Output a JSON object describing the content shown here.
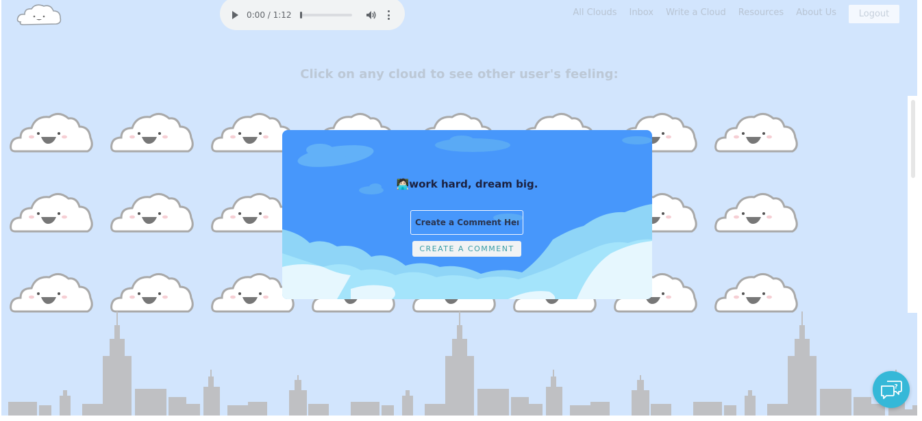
{
  "header": {
    "logo_icon": "cloud-logo-icon",
    "audio": {
      "time": "0:00 / 1:12"
    },
    "nav": [
      "All Clouds",
      "Inbox",
      "Write a Cloud",
      "Resources",
      "About Us"
    ],
    "logout_label": "Logout"
  },
  "main": {
    "headline": "Click on any cloud to see other user's feeling:",
    "cloud_icon": "smiling-cloud-icon"
  },
  "modal": {
    "post_text": "🧑🏻‍💻work hard, dream big.",
    "comment_placeholder": "Create a Comment Here",
    "comment_button": "CREATE A COMMENT"
  },
  "help": {
    "icon": "help-chat-icon"
  },
  "colors": {
    "page_bg": "#d2e5fd",
    "modal_bg": "#4797fb",
    "skyline": "#bfc0c3",
    "help_button": "#35b8d8",
    "button_text": "#3a9da6"
  }
}
